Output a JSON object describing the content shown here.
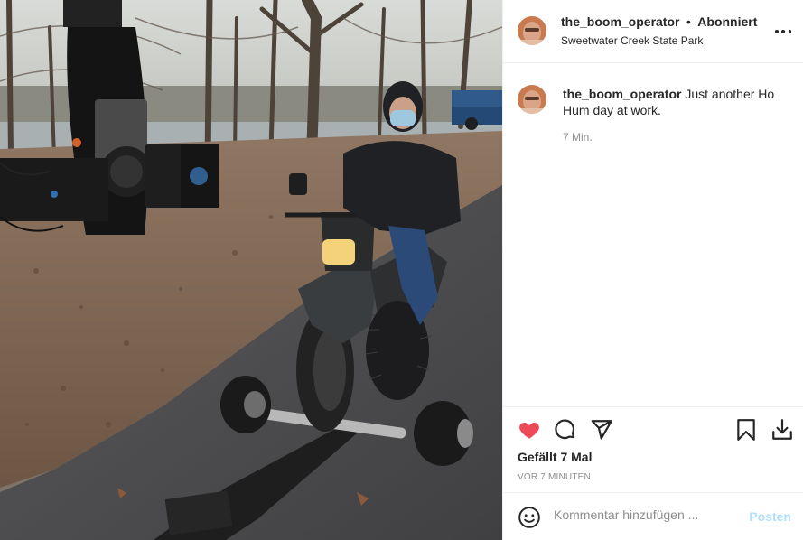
{
  "post": {
    "username": "the_boom_operator",
    "separator": "•",
    "follow_status": "Abonniert",
    "location": "Sweetwater Creek State Park"
  },
  "caption": {
    "username": "the_boom_operator",
    "text": "Just another Ho Hum day at work.",
    "time": "7 Min."
  },
  "actions": {
    "like_icon": "heart-filled-icon",
    "comment_icon": "comment-bubble-icon",
    "share_icon": "paper-plane-icon",
    "save_icon": "bookmark-icon",
    "download_icon": "download-icon",
    "like_color": "#ed4956"
  },
  "likes": "Gefällt 7 Mal",
  "posted_ago": "vor 7 Minuten",
  "comment_form": {
    "placeholder": "Kommentar hinzufügen ...",
    "post_label": "Posten"
  }
}
